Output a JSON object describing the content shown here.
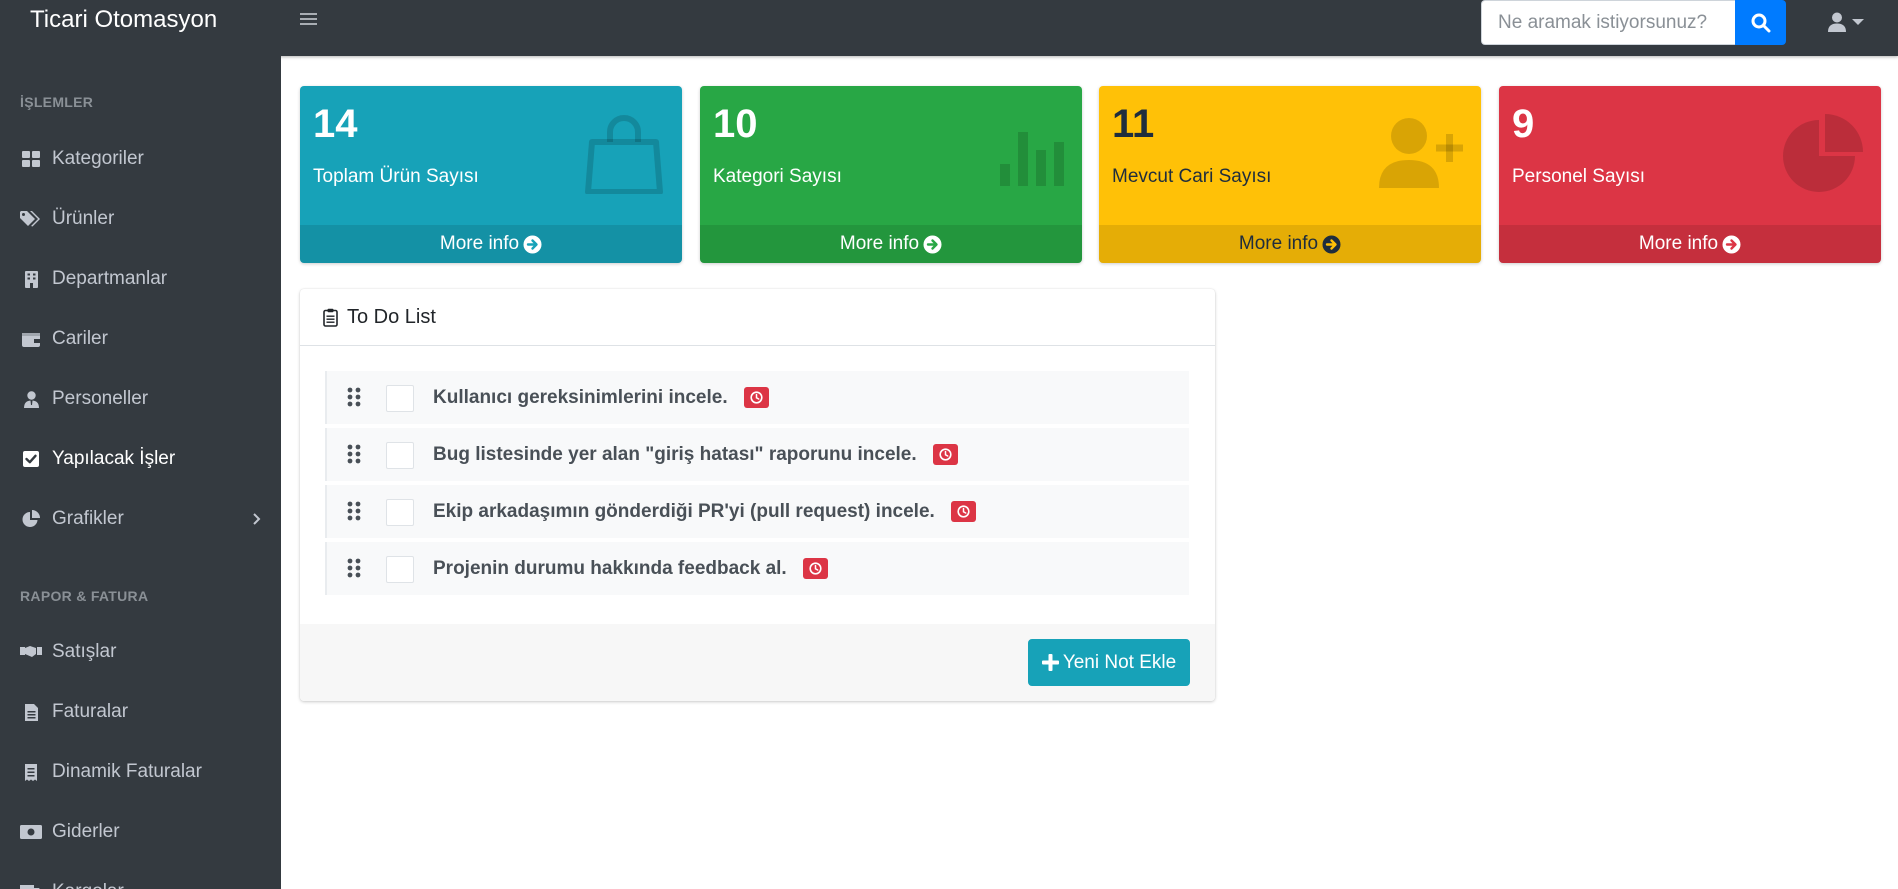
{
  "app": {
    "brand": "Ticari Otomasyon"
  },
  "navbar": {
    "menu_icon": "hamburger-icon",
    "search": {
      "placeholder": "Ne aramak istiyorsunuz?",
      "value": "",
      "button_icon": "search-icon"
    },
    "user_icon": "user-icon"
  },
  "sidebar": {
    "sections": [
      {
        "header": "İŞLEMLER"
      },
      {
        "header": "RAPOR & FATURA"
      }
    ],
    "items": [
      {
        "label": "Kategoriler",
        "icon": "grid-icon"
      },
      {
        "label": "Ürünler",
        "icon": "tags-icon"
      },
      {
        "label": "Departmanlar",
        "icon": "building-icon"
      },
      {
        "label": "Cariler",
        "icon": "wallet-icon"
      },
      {
        "label": "Personeller",
        "icon": "user-tie-icon"
      },
      {
        "label": "Yapılacak İşler",
        "icon": "check-square-icon",
        "active": true
      },
      {
        "label": "Grafikler",
        "icon": "pie-chart-icon",
        "has_submenu": true
      },
      {
        "label": "Satışlar",
        "icon": "handshake-icon"
      },
      {
        "label": "Faturalar",
        "icon": "file-invoice-icon"
      },
      {
        "label": "Dinamik Faturalar",
        "icon": "receipt-icon"
      },
      {
        "label": "Giderler",
        "icon": "money-bill-icon"
      },
      {
        "label": "Kargolar",
        "icon": "truck-icon"
      }
    ]
  },
  "stats": [
    {
      "value": "14",
      "label": "Toplam Ürün Sayısı",
      "more": "More info",
      "color": "#17a2b8",
      "icon": "shopping-bag-icon"
    },
    {
      "value": "10",
      "label": "Kategori Sayısı",
      "more": "More info",
      "color": "#28a745",
      "icon": "bar-chart-icon"
    },
    {
      "value": "11",
      "label": "Mevcut Cari Sayısı",
      "more": "More info",
      "color": "#ffc107",
      "icon": "user-plus-icon"
    },
    {
      "value": "9",
      "label": "Personel Sayısı",
      "more": "More info",
      "color": "#dc3545",
      "icon": "pie-chart-icon"
    }
  ],
  "todo": {
    "title": "To Do List",
    "title_icon": "clipboard-list-icon",
    "items": [
      {
        "text": "Kullanıcı gereksinimlerini incele.",
        "checked": false,
        "badge_icon": "clock-icon"
      },
      {
        "text": "Bug listesinde yer alan \"giriş hatası\" raporunu incele.",
        "checked": false,
        "badge_icon": "clock-icon"
      },
      {
        "text": "Ekip arkadaşımın gönderdiği PR'yi (pull request) incele.",
        "checked": false,
        "badge_icon": "clock-icon"
      },
      {
        "text": "Projenin durumu hakkında feedback al.",
        "checked": false,
        "badge_icon": "clock-icon"
      }
    ],
    "add_button": "Yeni Not Ekle"
  }
}
